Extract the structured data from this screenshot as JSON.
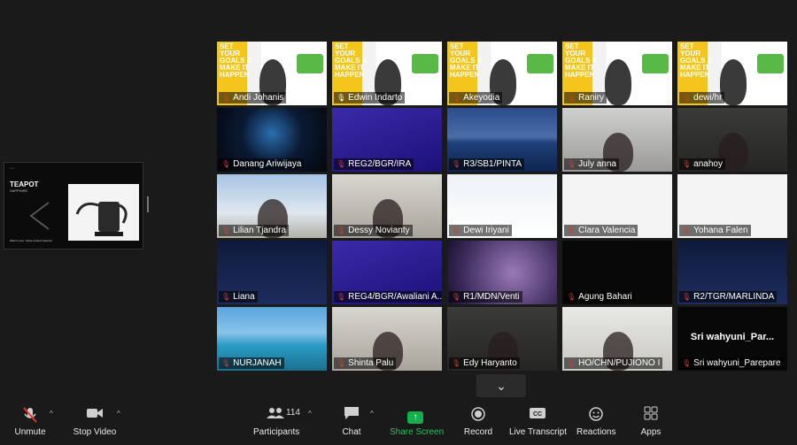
{
  "shared_screen": {
    "title": "TEAPOT",
    "subtitle": "SAPPHIRE",
    "caption": "Watch more: Kettle product features"
  },
  "tiles": [
    {
      "name": "Andi Johanis",
      "bg": "goals",
      "muted": true,
      "banner": "SET YOUR GOALS & MAKE IT HAPPEN"
    },
    {
      "name": "Edwin Indarto",
      "bg": "goals",
      "muted": false,
      "active": true,
      "banner": "SET YOUR GOALS & MAKE IT HAPPEN"
    },
    {
      "name": "Akeyodia",
      "bg": "goals",
      "muted": true,
      "banner": "SET YOUR GOALS & MAKE IT HAPPEN"
    },
    {
      "name": "Raniry",
      "bg": "goals",
      "muted": true,
      "banner": "SET YOUR GOALS & MAKE IT HAPPEN"
    },
    {
      "name": "dewi/hr",
      "bg": "goals",
      "muted": true,
      "banner": "SET YOUR GOALS & MAKE IT HAPPEN"
    },
    {
      "name": "Danang Ariwijaya",
      "bg": "space",
      "muted": true
    },
    {
      "name": "REG2/BGR/IRA",
      "bg": "purple",
      "muted": true
    },
    {
      "name": "R3/SB1/PINTA",
      "bg": "sea",
      "muted": true
    },
    {
      "name": "July anna",
      "bg": "office",
      "muted": true
    },
    {
      "name": "anahoy",
      "bg": "dark-office",
      "muted": true
    },
    {
      "name": "Lilian Tjandra",
      "bg": "sky",
      "muted": true
    },
    {
      "name": "Dessy Novianty",
      "bg": "room",
      "muted": true
    },
    {
      "name": "Dewi Iriyani",
      "bg": "xmas",
      "muted": true
    },
    {
      "name": "Clara Valencia",
      "bg": "white",
      "muted": true
    },
    {
      "name": "Yohana Falen",
      "bg": "white",
      "muted": true
    },
    {
      "name": "Liana",
      "bg": "navy",
      "muted": true
    },
    {
      "name": "REG4/BGR/Awaliani A...",
      "bg": "purple",
      "muted": true
    },
    {
      "name": "R1/MDN/Venti",
      "bg": "glitter",
      "muted": true
    },
    {
      "name": "Agung Bahari",
      "bg": "black",
      "muted": true
    },
    {
      "name": "R2/TGR/MARLINDA",
      "bg": "navy",
      "muted": true
    },
    {
      "name": "NURJANAH",
      "bg": "island",
      "muted": true
    },
    {
      "name": "Shinta Palu",
      "bg": "room",
      "muted": true
    },
    {
      "name": "Edy Haryanto",
      "bg": "dark-office",
      "muted": true
    },
    {
      "name": "HO/CHN/PUJIONO I",
      "bg": "lab",
      "muted": true
    },
    {
      "name": "Sri wahyuni_Parepare",
      "bg": "black",
      "muted": true,
      "big_name": "Sri  wahyuni_Par..."
    }
  ],
  "toolbar": {
    "unmute": "Unmute",
    "stop_video": "Stop Video",
    "participants": "Participants",
    "participants_count": "114",
    "chat": "Chat",
    "share_screen": "Share Screen",
    "record": "Record",
    "live_transcript": "Live Transcript",
    "reactions": "Reactions",
    "apps": "Apps"
  }
}
